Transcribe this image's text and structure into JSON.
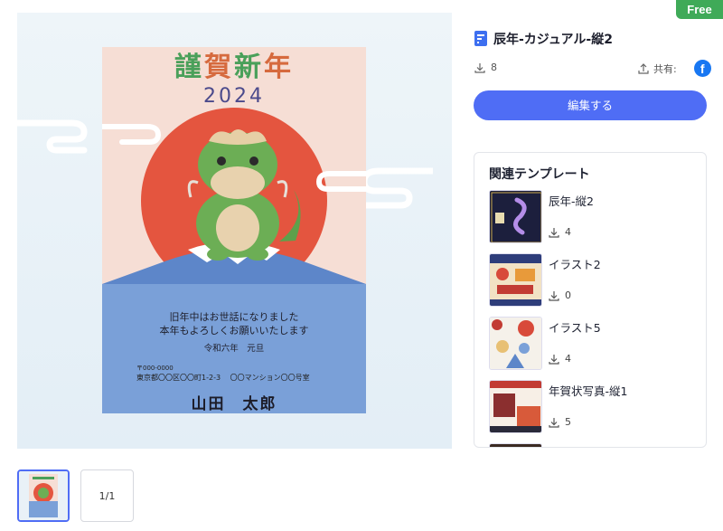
{
  "badge": {
    "label": "Free"
  },
  "template": {
    "title": "辰年-カジュアル-縦2",
    "downloads": "8",
    "share_label": "共有:",
    "share_icon": "facebook-icon",
    "edit_label": "編集する"
  },
  "card": {
    "title_chars": [
      "謹",
      "賀",
      "新",
      "年"
    ],
    "title_colors": [
      "#4aa05a",
      "#d66a3e",
      "#4aa05a",
      "#d66a3e"
    ],
    "year": "2024",
    "greeting_line1": "旧年中はお世話になりました",
    "greeting_line2": "本年もよろしくお願いいたします",
    "date_line": "令和六年　元旦",
    "zip": "〒000-0000",
    "address": "東京都〇〇区〇〇町1-2-3　 〇〇マンション〇〇号室",
    "sender": "山田　太郎"
  },
  "related": {
    "heading": "関連テンプレート",
    "items": [
      {
        "name": "辰年-縦2",
        "downloads": "4"
      },
      {
        "name": "イラスト2",
        "downloads": "0"
      },
      {
        "name": "イラスト5",
        "downloads": "4"
      },
      {
        "name": "年賀状写真-縦1",
        "downloads": "5"
      }
    ]
  },
  "pages": {
    "count_label": "1/1"
  },
  "colors": {
    "accent": "#4f6df5",
    "free_badge": "#3faa58",
    "facebook": "#1877f2"
  }
}
